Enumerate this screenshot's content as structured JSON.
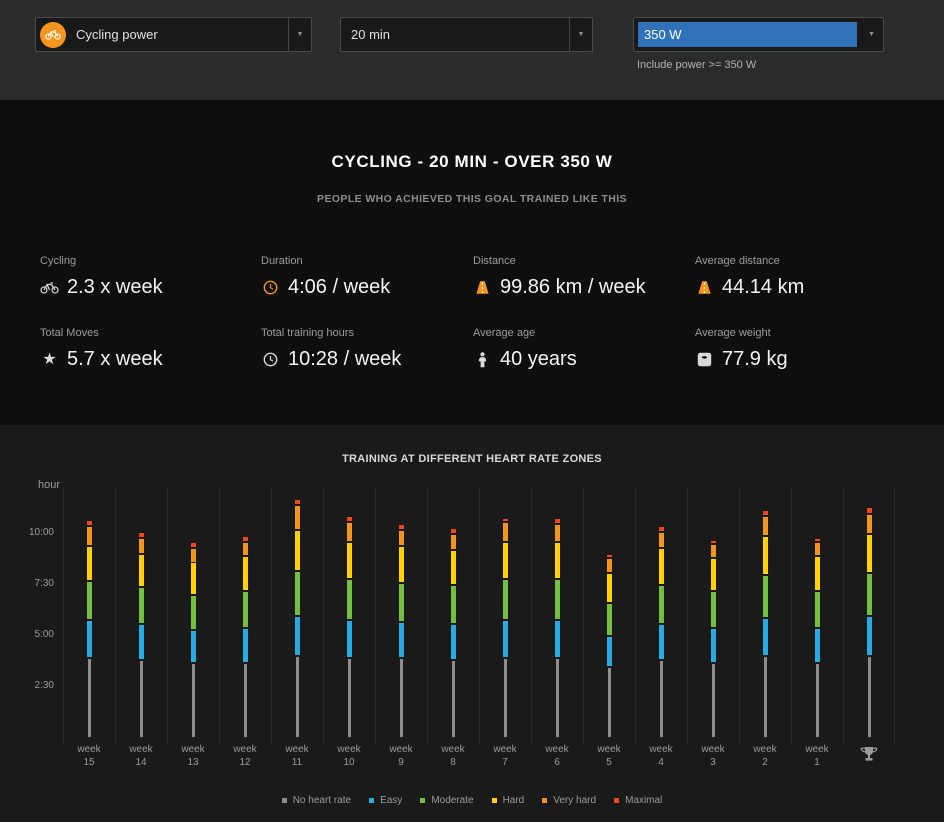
{
  "header": {
    "sport_filter": {
      "label": "Cycling power"
    },
    "duration_filter": {
      "label": "20 min"
    },
    "power_filter": {
      "label": "350 W",
      "note": "Include power >= 350 W"
    }
  },
  "summary": {
    "title": "CYCLING - 20 MIN - OVER 350 W",
    "subtitle": "PEOPLE WHO ACHIEVED THIS GOAL TRAINED LIKE THIS",
    "stats": [
      {
        "label": "Cycling",
        "value": "2.3 x week",
        "icon": "bike-icon"
      },
      {
        "label": "Duration",
        "value": "4:06 / week",
        "icon": "clock-icon"
      },
      {
        "label": "Distance",
        "value": "99.86 km / week",
        "icon": "road-icon"
      },
      {
        "label": "Average distance",
        "value": "44.14 km",
        "icon": "road-icon"
      },
      {
        "label": "Total Moves",
        "value": "5.7 x week",
        "icon": "star-icon"
      },
      {
        "label": "Total training hours",
        "value": "10:28 / week",
        "icon": "clock-icon"
      },
      {
        "label": "Average age",
        "value": "40 years",
        "icon": "person-icon"
      },
      {
        "label": "Average weight",
        "value": "77.9 kg",
        "icon": "scale-icon"
      }
    ]
  },
  "chart_data": {
    "type": "bar",
    "stacked": true,
    "title": "TRAINING AT DIFFERENT HEART RATE ZONES",
    "ylabel": "hour",
    "unit": "hours",
    "ylim": [
      0,
      12.25
    ],
    "grid": "vertical-column-separators",
    "legend_position": "bottom",
    "yticks": [
      {
        "label": "10:00",
        "hours": 10
      },
      {
        "label": "7:30",
        "hours": 7.5
      },
      {
        "label": "5:00",
        "hours": 5
      },
      {
        "label": "2:30",
        "hours": 2.5
      }
    ],
    "zones": [
      {
        "name": "No heart rate",
        "color": "#8d8d8d"
      },
      {
        "name": "Easy",
        "color": "#29abe2"
      },
      {
        "name": "Moderate",
        "color": "#72bf44"
      },
      {
        "name": "Hard",
        "color": "#ffd200"
      },
      {
        "name": "Very hard",
        "color": "#f7941e"
      },
      {
        "name": "Maximal",
        "color": "#f1471d"
      }
    ],
    "weeks": [
      {
        "line1": "week",
        "line2": "15",
        "values": [
          3.9,
          1.9,
          1.9,
          1.7,
          1.0,
          0.3
        ]
      },
      {
        "line1": "week",
        "line2": "14",
        "values": [
          3.8,
          1.8,
          1.8,
          1.6,
          0.8,
          0.3
        ]
      },
      {
        "line1": "week",
        "line2": "13",
        "values": [
          3.7,
          1.6,
          1.7,
          1.6,
          0.7,
          0.3
        ]
      },
      {
        "line1": "week",
        "line2": "12",
        "values": [
          3.7,
          1.7,
          1.8,
          1.7,
          0.7,
          0.3
        ]
      },
      {
        "line1": "week",
        "line2": "11",
        "values": [
          4.0,
          2.0,
          2.2,
          2.0,
          1.2,
          0.3
        ]
      },
      {
        "line1": "week",
        "line2": "10",
        "values": [
          3.9,
          1.9,
          2.0,
          1.8,
          1.0,
          0.3
        ]
      },
      {
        "line1": "week",
        "line2": "9",
        "values": [
          3.9,
          1.8,
          1.9,
          1.8,
          0.8,
          0.3
        ]
      },
      {
        "line1": "week",
        "line2": "8",
        "values": [
          3.8,
          1.8,
          1.9,
          1.7,
          0.8,
          0.3
        ]
      },
      {
        "line1": "week",
        "line2": "7",
        "values": [
          3.9,
          1.9,
          2.0,
          1.8,
          1.0,
          0.2
        ]
      },
      {
        "line1": "week",
        "line2": "6",
        "values": [
          3.9,
          1.9,
          2.0,
          1.8,
          0.9,
          0.3
        ]
      },
      {
        "line1": "week",
        "line2": "5",
        "values": [
          3.5,
          1.5,
          1.6,
          1.5,
          0.7,
          0.2
        ]
      },
      {
        "line1": "week",
        "line2": "4",
        "values": [
          3.8,
          1.8,
          1.9,
          1.8,
          0.8,
          0.3
        ]
      },
      {
        "line1": "week",
        "line2": "3",
        "values": [
          3.7,
          1.7,
          1.8,
          1.6,
          0.7,
          0.2
        ]
      },
      {
        "line1": "week",
        "line2": "2",
        "values": [
          4.0,
          1.9,
          2.1,
          1.9,
          1.0,
          0.3
        ]
      },
      {
        "line1": "week",
        "line2": "1",
        "values": [
          3.7,
          1.7,
          1.8,
          1.7,
          0.7,
          0.2
        ]
      },
      {
        "trophy": true,
        "values": [
          4.0,
          2.0,
          2.1,
          1.9,
          1.0,
          0.3
        ]
      }
    ]
  },
  "colors": {
    "accent_orange": "#f7941e",
    "selection_blue": "#2f72b9"
  }
}
